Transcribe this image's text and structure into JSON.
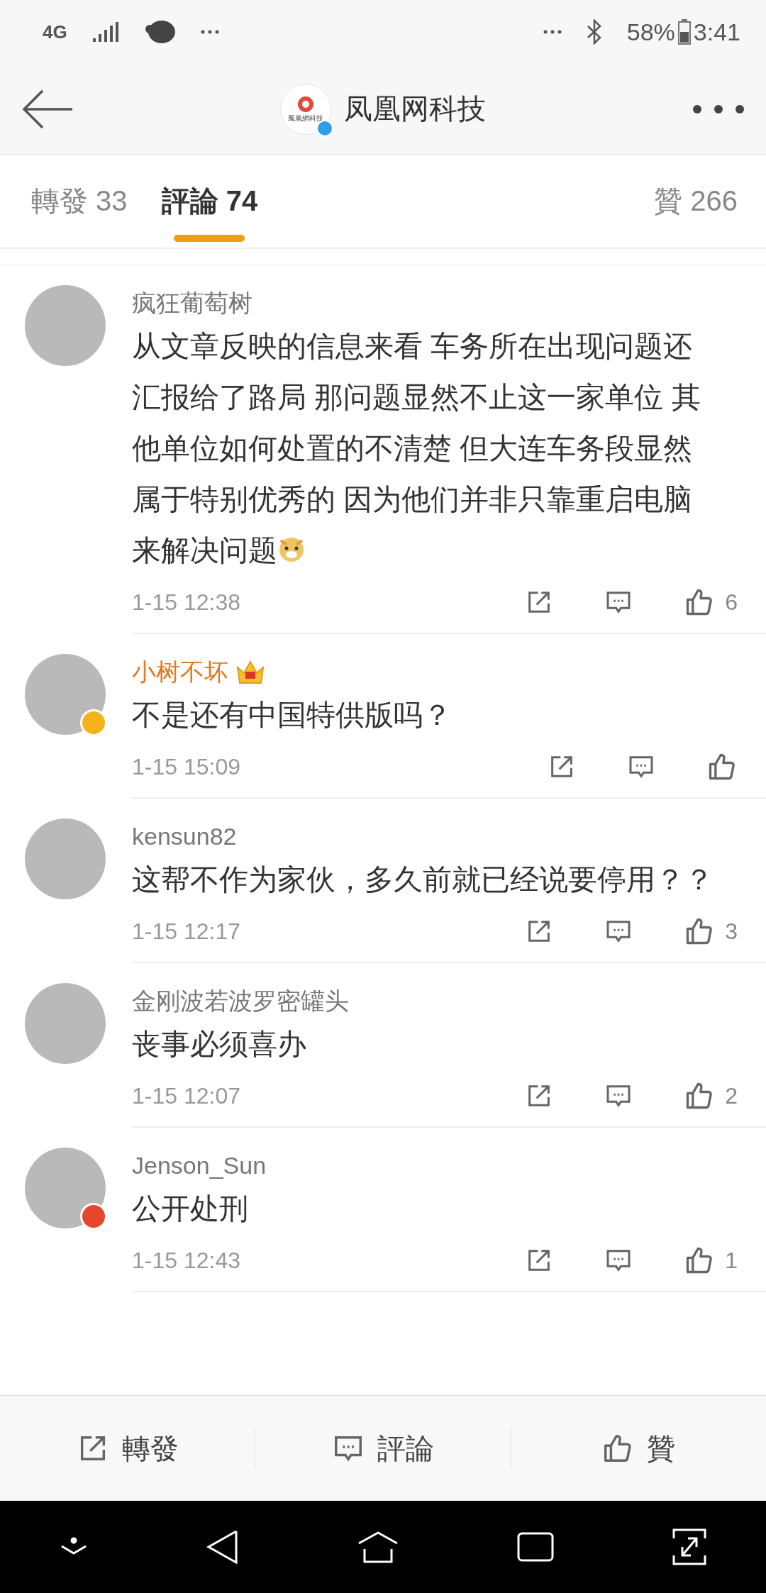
{
  "status_bar": {
    "network": "4G",
    "battery": "58%",
    "time": "3:41"
  },
  "header": {
    "title": "凤凰网科技",
    "avatar_text": "鳳凰網科技",
    "verified": true
  },
  "tabs": [
    {
      "label": "轉發",
      "count": "33",
      "selected": false
    },
    {
      "label": "評論",
      "count": "74",
      "selected": true
    },
    {
      "label": "贊",
      "count": "266",
      "selected": false
    }
  ],
  "comments": [
    {
      "name": "疯狂葡萄树",
      "vip": false,
      "verified": false,
      "member": false,
      "text": "从文章反映的信息来看 车务所在出现问题还汇报给了路局 那问题显然不止这一家单位 其他单位如何处置的不清楚 但大连车务段显然属于特别优秀的 因为他们并非只靠重启电脑来解决问题",
      "emoji": true,
      "time": "1-15 12:38",
      "likes": "6"
    },
    {
      "name": "小树不坏",
      "vip": true,
      "verified": true,
      "member": false,
      "text": "不是还有中国特供版吗？",
      "emoji": false,
      "time": "1-15 15:09"
    },
    {
      "name": "kensun82",
      "vip": false,
      "verified": false,
      "member": false,
      "text": "这帮不作为家伙，多久前就已经说要停用？？",
      "emoji": false,
      "time": "1-15 12:17",
      "likes": "3"
    },
    {
      "name": "金刚波若波罗密罐头",
      "vip": false,
      "verified": false,
      "member": false,
      "text": "丧事必须喜办",
      "emoji": false,
      "time": "1-15 12:07",
      "likes": "2"
    },
    {
      "name": "Jenson_Sun",
      "vip": false,
      "verified": false,
      "member": true,
      "text": "公开处刑",
      "emoji": false,
      "time": "1-15 12:43",
      "likes": "1"
    }
  ],
  "actions": [
    {
      "kind": "repost",
      "label": "轉發"
    },
    {
      "kind": "comment",
      "label": "評論"
    },
    {
      "kind": "like",
      "label": "贊"
    }
  ]
}
